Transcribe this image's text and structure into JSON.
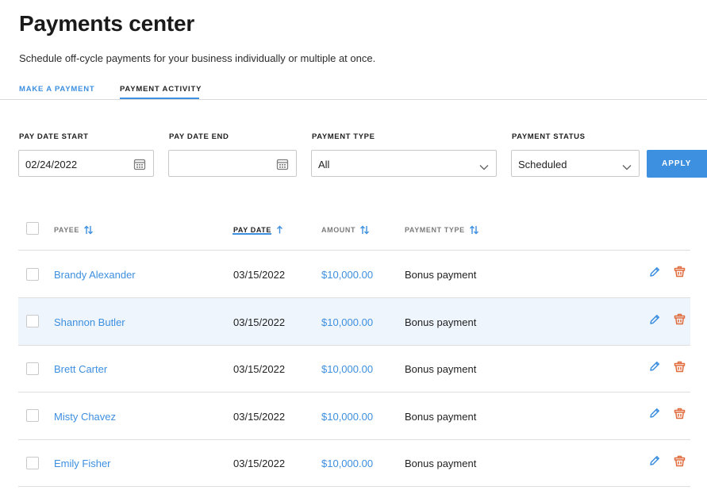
{
  "page": {
    "title": "Payments center",
    "subtitle": "Schedule off-cycle payments for your business individually or multiple at once."
  },
  "tabs": [
    {
      "label": "MAKE A PAYMENT",
      "active": false
    },
    {
      "label": "PAYMENT ACTIVITY",
      "active": true
    }
  ],
  "filters": {
    "pay_date_start": {
      "label": "PAY DATE START",
      "value": "02/24/2022",
      "icon": "calendar-icon"
    },
    "pay_date_end": {
      "label": "PAY DATE END",
      "value": "",
      "icon": "calendar-icon"
    },
    "payment_type": {
      "label": "PAYMENT TYPE",
      "value": "All",
      "icon": "chevron-down-icon"
    },
    "payment_status": {
      "label": "PAYMENT STATUS",
      "value": "Scheduled",
      "icon": "chevron-down-icon"
    },
    "apply_label": "APPLY"
  },
  "table": {
    "columns": [
      {
        "label": "PAYEE",
        "sort": "sortable"
      },
      {
        "label": "PAY DATE",
        "sort": "ascending"
      },
      {
        "label": "AMOUNT",
        "sort": "sortable"
      },
      {
        "label": "PAYMENT TYPE",
        "sort": "sortable"
      }
    ],
    "rows": [
      {
        "payee": "Brandy Alexander",
        "pay_date": "03/15/2022",
        "amount": "$10,000.00",
        "payment_type": "Bonus payment"
      },
      {
        "payee": "Shannon Butler",
        "pay_date": "03/15/2022",
        "amount": "$10,000.00",
        "payment_type": "Bonus payment"
      },
      {
        "payee": "Brett Carter",
        "pay_date": "03/15/2022",
        "amount": "$10,000.00",
        "payment_type": "Bonus payment"
      },
      {
        "payee": "Misty Chavez",
        "pay_date": "03/15/2022",
        "amount": "$10,000.00",
        "payment_type": "Bonus payment"
      },
      {
        "payee": "Emily Fisher",
        "pay_date": "03/15/2022",
        "amount": "$10,000.00",
        "payment_type": "Bonus payment"
      }
    ],
    "row_actions": [
      "edit-pencil-icon",
      "delete-trash-icon"
    ]
  },
  "colors": {
    "accent": "#3d8fe0",
    "delete": "#e06b3d",
    "row_highlight": "#eef5fc"
  }
}
